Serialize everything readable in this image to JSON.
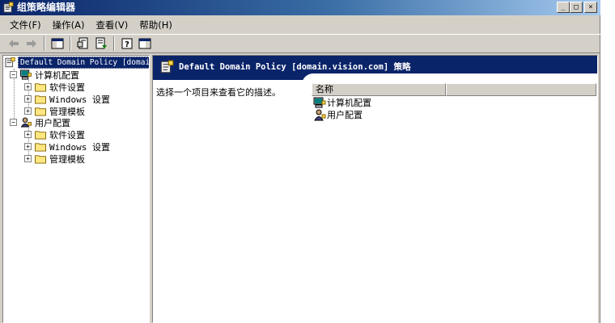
{
  "window": {
    "title": "组策略编辑器",
    "minimize_glyph": "_",
    "maximize_glyph": "□",
    "close_glyph": "×"
  },
  "menu": [
    "文件(F)",
    "操作(A)",
    "查看(V)",
    "帮助(H)"
  ],
  "toolbar": {
    "icons": [
      "back-arrow-icon",
      "forward-arrow-icon",
      "show-hide-tree-icon",
      "properties-icon",
      "export-list-icon",
      "help-icon",
      "console-pane-icon"
    ]
  },
  "tree": {
    "root": "Default Domain Policy [domai",
    "computer_config": "计算机配置",
    "user_config": "用户配置",
    "software_settings": "软件设置",
    "windows_settings": "Windows 设置",
    "admin_templates": "管理模板",
    "expand_glyph": "+",
    "collapse_glyph": "−"
  },
  "details": {
    "banner_title": "Default Domain Policy [domain.vision.com] 策略",
    "description": "选择一个项目来查看它的描述。",
    "column_name": "名称",
    "items": [
      "计算机配置",
      "用户配置"
    ]
  },
  "colors": {
    "titlebar_start": "#0a246a",
    "titlebar_end": "#a6caf0",
    "face": "#d4d0c8",
    "banner": "#0a246a",
    "selection": "#0a246a"
  }
}
